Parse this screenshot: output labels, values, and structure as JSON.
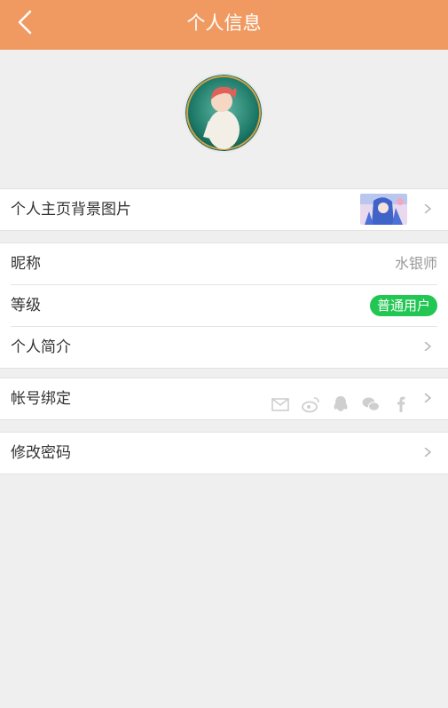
{
  "header": {
    "title": "个人信息"
  },
  "background_image_row": {
    "label": "个人主页背景图片"
  },
  "profile_rows": [
    {
      "label": "昵称",
      "value": "水银师"
    },
    {
      "label": "等级",
      "badge": "普通用户"
    },
    {
      "label": "个人简介"
    }
  ],
  "account_binding": {
    "label": "帐号绑定",
    "icons": [
      "email-icon",
      "weibo-icon",
      "qq-icon",
      "wechat-icon",
      "facebook-icon"
    ]
  },
  "change_password": {
    "label": "修改密码"
  },
  "colors": {
    "header_bg": "#f09a62",
    "badge_bg": "#22c653",
    "page_bg": "#efefef"
  }
}
